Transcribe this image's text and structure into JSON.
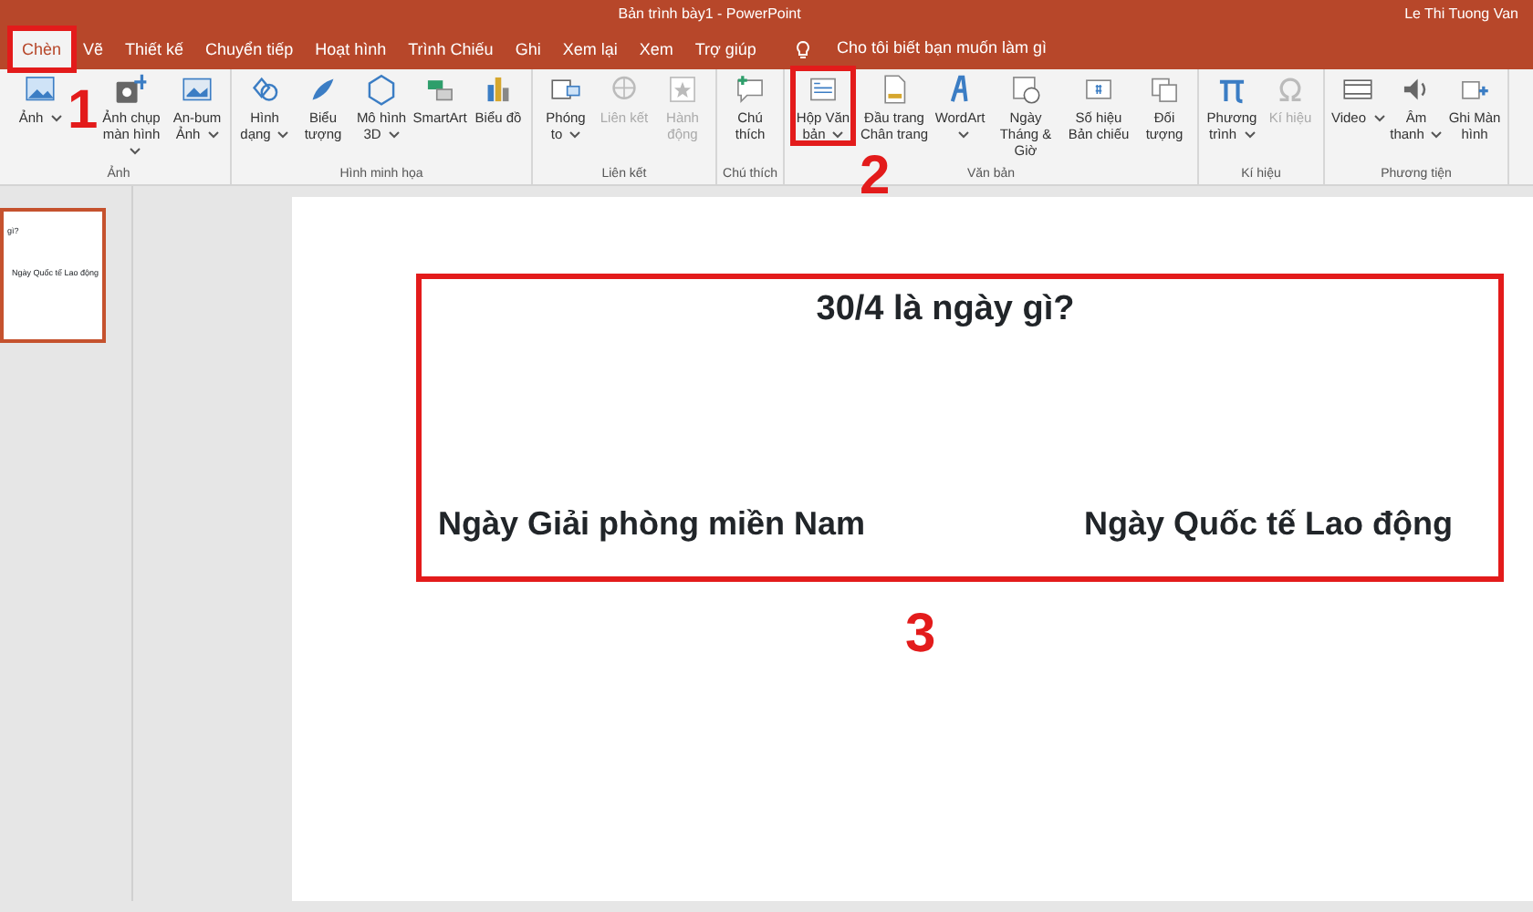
{
  "window": {
    "title": "Bản trình bày1 - PowerPoint",
    "user": "Le Thi Tuong Van"
  },
  "tabs": [
    {
      "label": "Chèn",
      "selected": true,
      "annotated": true
    },
    {
      "label": "Vẽ",
      "selected": false,
      "annotated": false
    },
    {
      "label": "Thiết kế",
      "selected": false,
      "annotated": false
    },
    {
      "label": "Chuyển tiếp",
      "selected": false,
      "annotated": false
    },
    {
      "label": "Hoạt hình",
      "selected": false,
      "annotated": false
    },
    {
      "label": "Trình Chiếu",
      "selected": false,
      "annotated": false
    },
    {
      "label": "Ghi",
      "selected": false,
      "annotated": false
    },
    {
      "label": "Xem lại",
      "selected": false,
      "annotated": false
    },
    {
      "label": "Xem",
      "selected": false,
      "annotated": false
    },
    {
      "label": "Trợ giúp",
      "selected": false,
      "annotated": false
    }
  ],
  "tell_me": {
    "placeholder": "Cho tôi biết bạn muốn làm gì"
  },
  "ribbon_groups": [
    {
      "label": "Ảnh",
      "buttons": [
        {
          "label": "Ảnh",
          "caret": true,
          "disabled": false,
          "annotated": false
        },
        {
          "label": "Ảnh chụp màn hình",
          "caret": true,
          "disabled": false,
          "annotated": false
        },
        {
          "label": "An-bum Ảnh",
          "caret": true,
          "disabled": false,
          "annotated": false
        }
      ]
    },
    {
      "label": "Hình minh họa",
      "buttons": [
        {
          "label": "Hình dạng",
          "caret": true,
          "disabled": false,
          "annotated": false
        },
        {
          "label": "Biểu tượng",
          "caret": false,
          "disabled": false,
          "annotated": false
        },
        {
          "label": "Mô hình 3D",
          "caret": true,
          "disabled": false,
          "annotated": false
        },
        {
          "label": "SmartArt",
          "caret": false,
          "disabled": false,
          "annotated": false
        },
        {
          "label": "Biểu đồ",
          "caret": false,
          "disabled": false,
          "annotated": false
        }
      ]
    },
    {
      "label": "Liên kết",
      "buttons": [
        {
          "label": "Phóng to",
          "caret": true,
          "disabled": false,
          "annotated": false
        },
        {
          "label": "Liên kết",
          "caret": false,
          "disabled": true,
          "annotated": false
        },
        {
          "label": "Hành động",
          "caret": false,
          "disabled": true,
          "annotated": false
        }
      ]
    },
    {
      "label": "Chú thích",
      "buttons": [
        {
          "label": "Chú thích",
          "caret": false,
          "disabled": false,
          "annotated": false
        }
      ]
    },
    {
      "label": "Văn bản",
      "buttons": [
        {
          "label": "Hộp Văn bản",
          "caret": true,
          "disabled": false,
          "annotated": true
        },
        {
          "label": "Đầu trang Chân trang",
          "caret": false,
          "disabled": false,
          "annotated": false
        },
        {
          "label": "WordArt",
          "caret": true,
          "disabled": false,
          "annotated": false
        },
        {
          "label": "Ngày Tháng & Giờ",
          "caret": false,
          "disabled": false,
          "annotated": false
        },
        {
          "label": "Số hiệu Bản chiếu",
          "caret": false,
          "disabled": false,
          "annotated": false
        },
        {
          "label": "Đối tượng",
          "caret": false,
          "disabled": false,
          "annotated": false
        }
      ]
    },
    {
      "label": "Kí hiệu",
      "buttons": [
        {
          "label": "Phương trình",
          "caret": true,
          "disabled": false,
          "annotated": false
        },
        {
          "label": "Kí hiệu",
          "caret": false,
          "disabled": true,
          "annotated": false
        }
      ]
    },
    {
      "label": "Phương tiện",
      "buttons": [
        {
          "label": "Video",
          "caret": true,
          "disabled": false,
          "annotated": false
        },
        {
          "label": "Âm thanh",
          "caret": true,
          "disabled": false,
          "annotated": false
        },
        {
          "label": "Ghi Màn hình",
          "caret": false,
          "disabled": false,
          "annotated": false
        }
      ]
    }
  ],
  "thumbnail": {
    "texts": [
      "gì?",
      "Ngày Quốc tế Lao động"
    ],
    "selected": true
  },
  "slide": {
    "title": "30/4 là ngày gì?",
    "annotated": true,
    "options": [
      "Ngày Giải phòng miền Nam",
      "Ngày Quốc tế Lao động"
    ]
  },
  "annotations": [
    {
      "label": "1"
    },
    {
      "label": "2"
    },
    {
      "label": "3"
    }
  ]
}
